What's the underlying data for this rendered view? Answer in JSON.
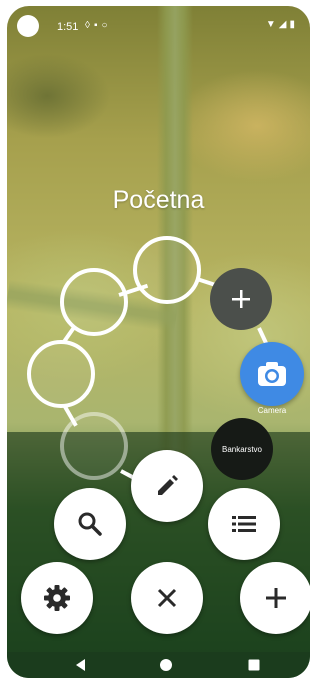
{
  "status_bar": {
    "time": "1:51"
  },
  "page": {
    "title": "Početna"
  },
  "radial_menu": {
    "add_button": {
      "icon": "plus-icon"
    },
    "camera_button": {
      "label": "Camera",
      "icon": "camera-icon"
    },
    "bank_button": {
      "label": "Bankarstvo"
    }
  },
  "fab_menu": {
    "search": {
      "icon": "search-icon"
    },
    "edit": {
      "icon": "pencil-icon"
    },
    "list": {
      "icon": "list-icon"
    },
    "settings": {
      "icon": "gear-icon"
    },
    "close": {
      "icon": "close-icon"
    },
    "add": {
      "icon": "plus-icon"
    }
  },
  "navigation": {
    "back": "back-icon",
    "home": "home-icon",
    "recents": "recents-icon"
  }
}
